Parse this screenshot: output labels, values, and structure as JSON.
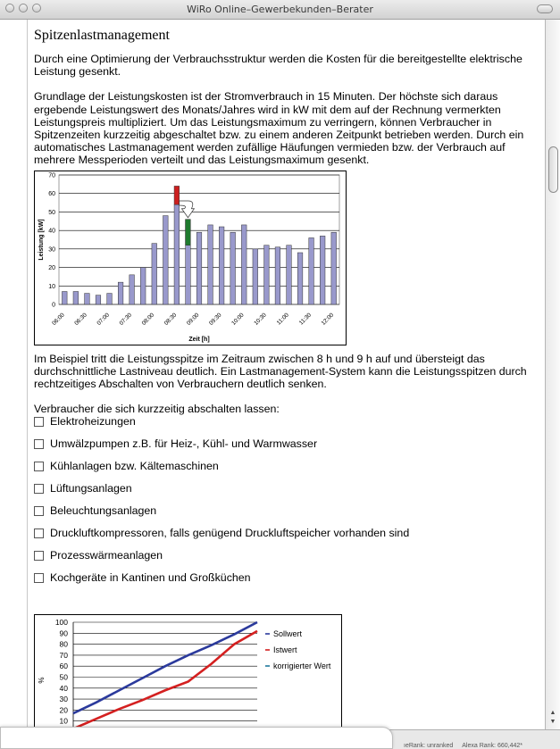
{
  "window": {
    "title": "WiRo Online–Gewerbekunden–Berater"
  },
  "page": {
    "heading": "Spitzenlastmanagement",
    "intro": "Durch eine Optimierung der Verbrauchsstruktur werden die Kosten für die bereitgestellte elektrische Leistung gesenkt.",
    "basis": "Grundlage der Leistungskosten ist der Stromverbrauch in 15 Minuten. Der höchste sich daraus ergebende Leistungswert des Monats/Jahres wird in kW mit dem auf der Rechnung vermerkten Leistungspreis multipliziert. Um das Leistungsmaximum zu verringern, können Verbraucher in Spitzenzeiten kurzzeitig abgeschaltet bzw. zu einem anderen Zeitpunkt betrieben werden. Durch ein automatisches Lastmanagement werden zufällige Häufungen vermieden bzw. der Verbrauch auf mehrere Messperioden verteilt und das Leistungsmaximum gesenkt.",
    "example": "Im Beispiel tritt die Leistungsspitze im Zeitraum zwischen 8 h und 9 h auf und übersteigt das durchschnittliche Lastniveau deutlich. Ein Lastmanagement-System kann die Leistungsspitzen durch rechtzeitiges Abschalten von Verbrauchern deutlich senken.",
    "list_intro": "Verbraucher die sich kurzzeitig abschalten lassen:",
    "consumers": [
      "Elektroheizungen",
      "Umwälzpumpen z.B. für Heiz-, Kühl- und Warmwasser",
      "Kühlanlagen bzw. Kältemaschinen",
      "Lüftungsanlagen",
      "Beleuchtungsanlagen",
      "Druckluftkompressoren, falls genügend Druckluftspeicher vorhanden sind",
      "Prozesswärmeanlagen",
      "Kochgeräte in Kantinen und Großküchen"
    ]
  },
  "status": {
    "pagerank": "ıeRank: unranked",
    "alexa": "Alexa Rank: 660,442*"
  },
  "colors": {
    "bar": "#9999cc",
    "peak_red": "#cc1f1f",
    "peak_green": "#1f7a2e",
    "soll": "#2b3a9c",
    "ist": "#d42020",
    "korr": "#1f7a9c"
  },
  "chart_data": [
    {
      "type": "bar",
      "xlabel": "Zeit [h]",
      "ylabel": "Leistung [kW]",
      "ylim": [
        0,
        70
      ],
      "yticks": [
        0,
        10,
        20,
        30,
        40,
        50,
        60,
        70
      ],
      "tick_labels": [
        "06:00",
        "06:30",
        "07:00",
        "07:30",
        "08:00",
        "08:30",
        "09:00",
        "09:30",
        "10:00",
        "10:30",
        "11:00",
        "11:30",
        "12:00"
      ],
      "values": [
        7,
        7,
        6,
        5,
        6,
        12,
        16,
        20,
        33,
        48,
        54,
        46,
        39,
        43,
        42,
        39,
        43,
        30,
        32,
        31,
        32,
        28,
        36,
        37,
        39
      ],
      "peak": {
        "index": 10,
        "value": 64,
        "shifted_to_index": 11,
        "shifted_from": 46,
        "shifted_to": 32
      },
      "grid": true
    },
    {
      "type": "line",
      "ylabel": "%",
      "ylim": [
        0,
        100
      ],
      "yticks": [
        10,
        20,
        30,
        40,
        50,
        60,
        70,
        80,
        90,
        100
      ],
      "grid": true,
      "legend_position": "right",
      "series": [
        {
          "name": "Sollwert",
          "color": "#2b3a9c",
          "x": [
            0,
            1,
            2,
            3,
            4,
            5,
            6,
            7,
            8
          ],
          "values": [
            17,
            27,
            38,
            49,
            60,
            70,
            79,
            89,
            100
          ]
        },
        {
          "name": "Istwert",
          "color": "#d42020",
          "x": [
            0,
            1,
            2,
            3,
            4,
            5,
            6,
            7,
            8
          ],
          "values": [
            3,
            12,
            21,
            29,
            38,
            46,
            62,
            80,
            92
          ]
        },
        {
          "name": "korrigierter Wert",
          "color": "#1f7a9c",
          "x": [],
          "values": []
        }
      ]
    }
  ]
}
